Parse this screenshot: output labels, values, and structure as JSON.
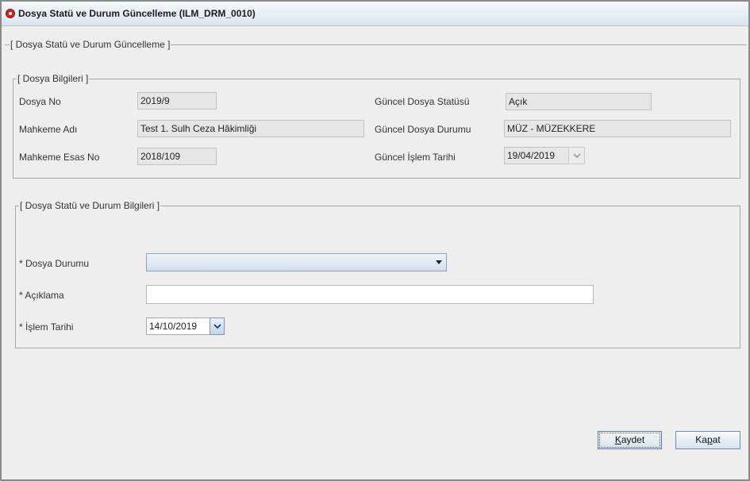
{
  "window": {
    "title": "Dosya Statü ve Durum Güncelleme (ILM_DRM_0010)"
  },
  "main_panel": {
    "legend": "[ Dosya Statü ve Durum Güncelleme ]"
  },
  "file_info": {
    "legend": "[ Dosya Bilgileri ]",
    "dosya_no": {
      "label": "Dosya No",
      "value": "2019/9"
    },
    "mahkeme_adi": {
      "label": "Mahkeme Adı",
      "value": "Test 1. Sulh Ceza Hâkimliği"
    },
    "mahkeme_esas_no": {
      "label": "Mahkeme Esas No",
      "value": "2018/109"
    },
    "guncel_dosya_statusu": {
      "label": "Güncel Dosya Statüsü",
      "value": "Açık"
    },
    "guncel_dosya_durumu": {
      "label": "Güncel Dosya Durumu",
      "value": "MÜZ - MÜZEKKERE"
    },
    "guncel_islem_tarihi": {
      "label": "Güncel İşlem Tarihi",
      "value": "19/04/2019",
      "icon": "chevron-down-icon"
    }
  },
  "status_info": {
    "legend": "[ Dosya Statü ve Durum Bilgileri ]",
    "dosya_durumu": {
      "label": "* Dosya Durumu",
      "value": "",
      "icon": "dropdown-arrow-icon"
    },
    "aciklama": {
      "label": "* Açıklama",
      "value": ""
    },
    "islem_tarihi": {
      "label": "* İşlem Tarihi",
      "value": "14/10/2019",
      "icon": "chevron-down-icon"
    }
  },
  "buttons": {
    "kaydet": {
      "before": "",
      "mnemonic": "K",
      "after": "aydet"
    },
    "kapat": {
      "before": "Ka",
      "mnemonic": "p",
      "after": "at"
    }
  }
}
